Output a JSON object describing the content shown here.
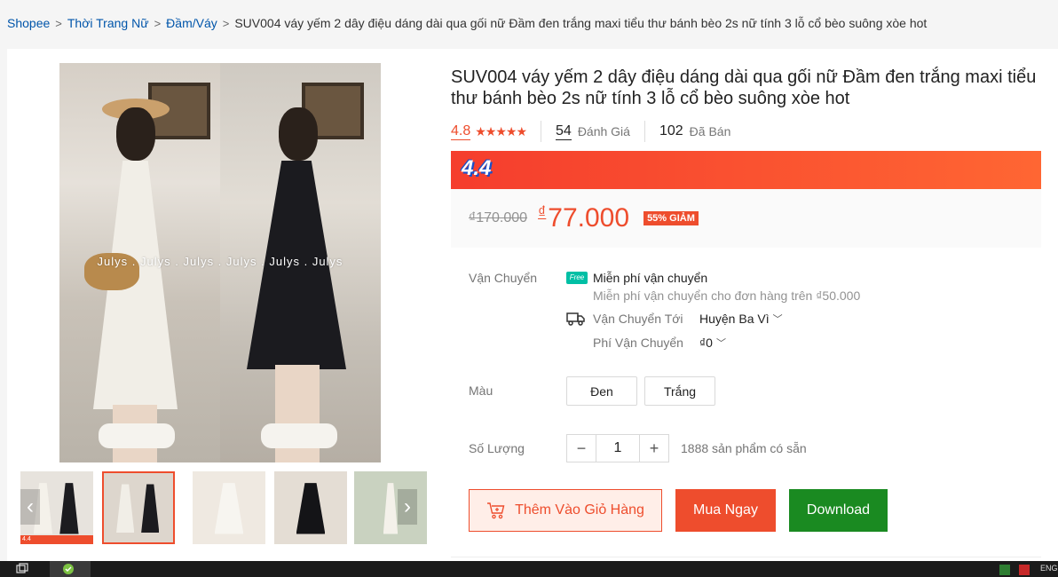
{
  "breadcrumb": {
    "items": [
      "Shopee",
      "Thời Trang Nữ",
      "Đầm/Váy"
    ],
    "current": "SUV004 váy yếm 2 dây điệu dáng dài qua gối nữ Đầm đen trắng maxi tiểu thư bánh bèo 2s nữ tính 3 lỗ cổ bèo suông xòe hot"
  },
  "gallery": {
    "watermark": "Julys . Julys . Julys . Julys . Julys . Julys",
    "thumb_badge": "4.4",
    "prev_icon": "chevron-left-icon",
    "next_icon": "chevron-right-icon",
    "selected_thumb": 2,
    "thumb_count": 5
  },
  "product": {
    "title": "SUV004 váy yếm 2 dây điệu dáng dài qua gối nữ Đầm đen trắng maxi tiểu thư bánh bèo 2s nữ tính 3 lỗ cổ bèo suông xòe hot",
    "rating": "4.8",
    "stars": "★★★★★",
    "reviews_count": "54",
    "reviews_label": "Đánh Giá",
    "sold_count": "102",
    "sold_label": "Đã Bán"
  },
  "flash_sale": {
    "logo": "4.4"
  },
  "price": {
    "old": "₫170.000",
    "currency": "₫",
    "current": "77.000",
    "discount": "55% GIẢM"
  },
  "shipping": {
    "label": "Vận Chuyển",
    "free_badge": "Free",
    "free_title": "Miễn phí vận chuyển",
    "free_desc": "Miễn phí vận chuyển cho đơn hàng trên ₫50.000",
    "to_label": "Vận Chuyển Tới",
    "to_value": "Huyện Ba Vì",
    "fee_label": "Phí Vận Chuyển",
    "fee_value": "₫0"
  },
  "color": {
    "label": "Màu",
    "options": [
      "Đen",
      "Trắng"
    ]
  },
  "quantity": {
    "label": "Số Lượng",
    "minus": "−",
    "value": "1",
    "plus": "+",
    "stock": "1888 sản phẩm có sẵn"
  },
  "actions": {
    "add_to_cart": "Thêm Vào Giỏ Hàng",
    "buy_now": "Mua Ngay",
    "download": "Download"
  },
  "taskbar": {
    "lang": "ENG"
  },
  "colors": {
    "accent": "#ee4d2d",
    "link": "#0055aa",
    "download": "#1a8a21",
    "free_ship": "#00bfa5"
  }
}
